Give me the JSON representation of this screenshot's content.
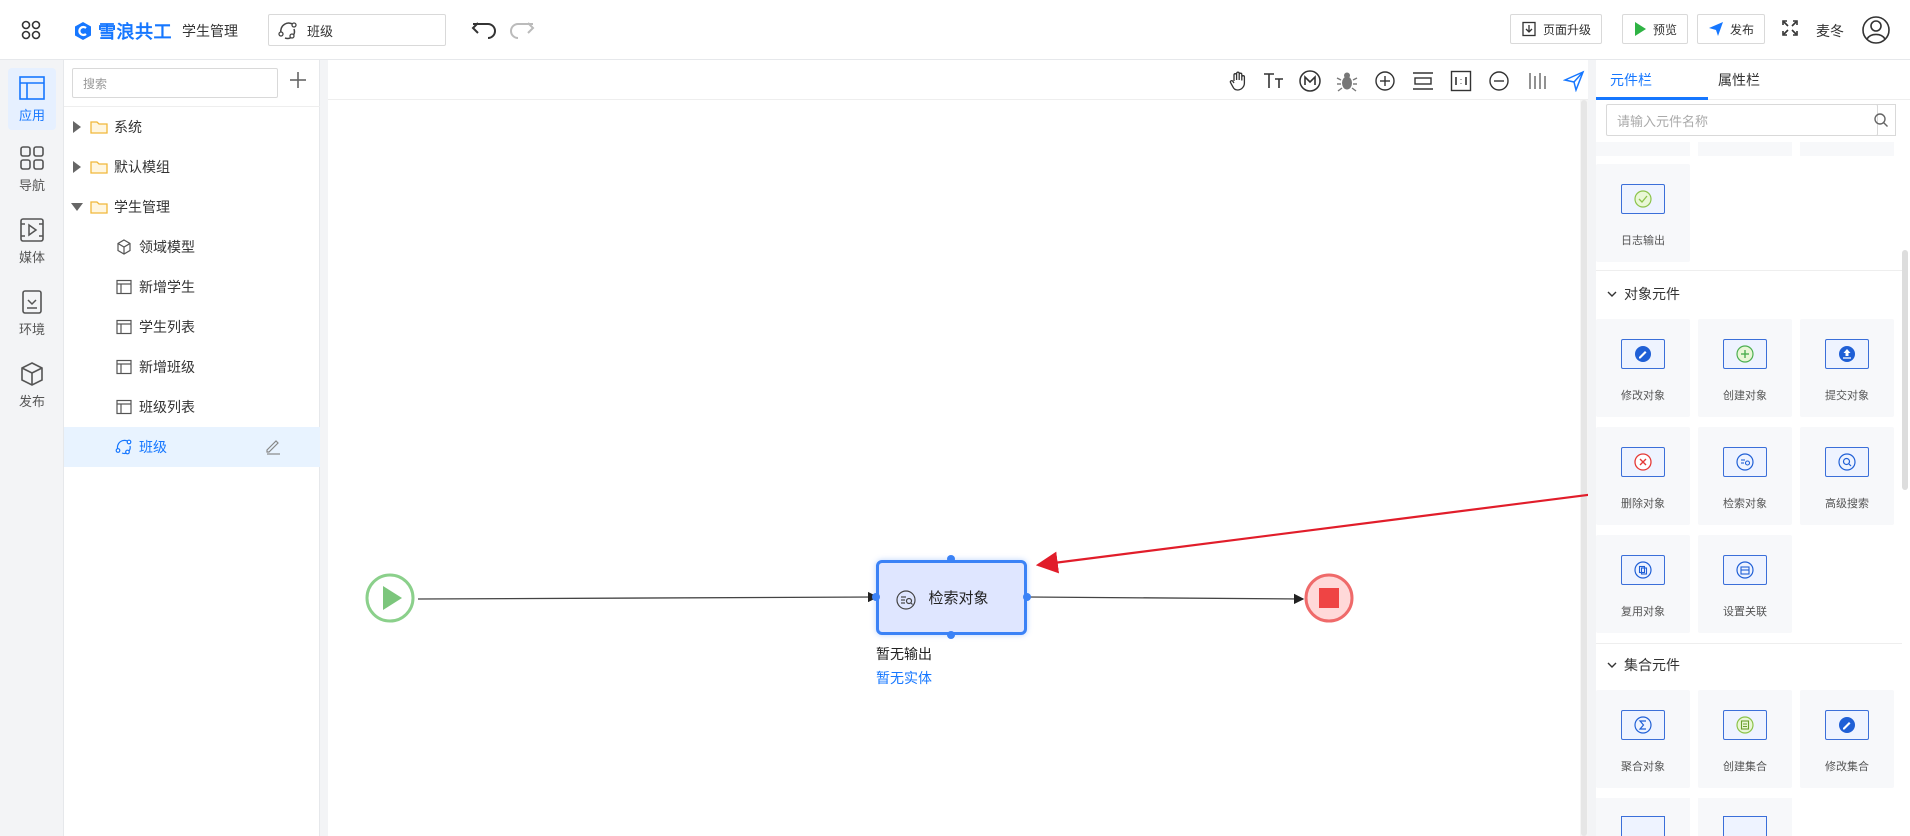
{
  "app": {
    "brand": "雪浪共工",
    "project": "学生管理",
    "current_flow": "班级",
    "buttons": {
      "upgrade": "页面升级",
      "preview": "预览",
      "publish": "发布"
    },
    "user": "麦冬"
  },
  "rail": [
    {
      "label": "应用",
      "icon": "app-icon"
    },
    {
      "label": "导航",
      "icon": "grid-icon"
    },
    {
      "label": "媒体",
      "icon": "media-icon"
    },
    {
      "label": "环境",
      "icon": "environment-icon"
    },
    {
      "label": "发布",
      "icon": "cube-icon"
    }
  ],
  "tree": {
    "search_placeholder": "搜索",
    "items": [
      {
        "label": "系统",
        "type": "folder",
        "expanded": false
      },
      {
        "label": "默认模组",
        "type": "folder",
        "expanded": false
      },
      {
        "label": "学生管理",
        "type": "folder",
        "expanded": true
      },
      {
        "label": "领域模型",
        "type": "model"
      },
      {
        "label": "新增学生",
        "type": "page"
      },
      {
        "label": "学生列表",
        "type": "page"
      },
      {
        "label": "新增班级",
        "type": "page"
      },
      {
        "label": "班级列表",
        "type": "page"
      },
      {
        "label": "班级",
        "type": "flow",
        "selected": true
      }
    ]
  },
  "canvas": {
    "tools": [
      "hand-icon",
      "text-icon",
      "m-icon",
      "bug-icon",
      "zoom-in-icon",
      "fit-height-icon",
      "actual-size-icon",
      "zoom-out-icon",
      "align-icon",
      "send-icon"
    ],
    "node": {
      "label": "检索对象",
      "output": "暂无输出",
      "entity": "暂无实体"
    }
  },
  "right_panel": {
    "tabs": [
      "元件栏",
      "属性栏"
    ],
    "search_placeholder": "请输入元件名称",
    "log_item": "日志输出",
    "sections": [
      {
        "title": "对象元件",
        "items": [
          "修改对象",
          "创建对象",
          "提交对象",
          "删除对象",
          "检索对象",
          "高级搜索",
          "复用对象",
          "设置关联"
        ]
      },
      {
        "title": "集合元件",
        "items": [
          "聚合对象",
          "创建集合",
          "修改集合"
        ]
      }
    ]
  },
  "colors": {
    "accent": "#1677ff",
    "start": "#4caf50",
    "end": "#ef4444",
    "arrow": "#e11d2a"
  }
}
